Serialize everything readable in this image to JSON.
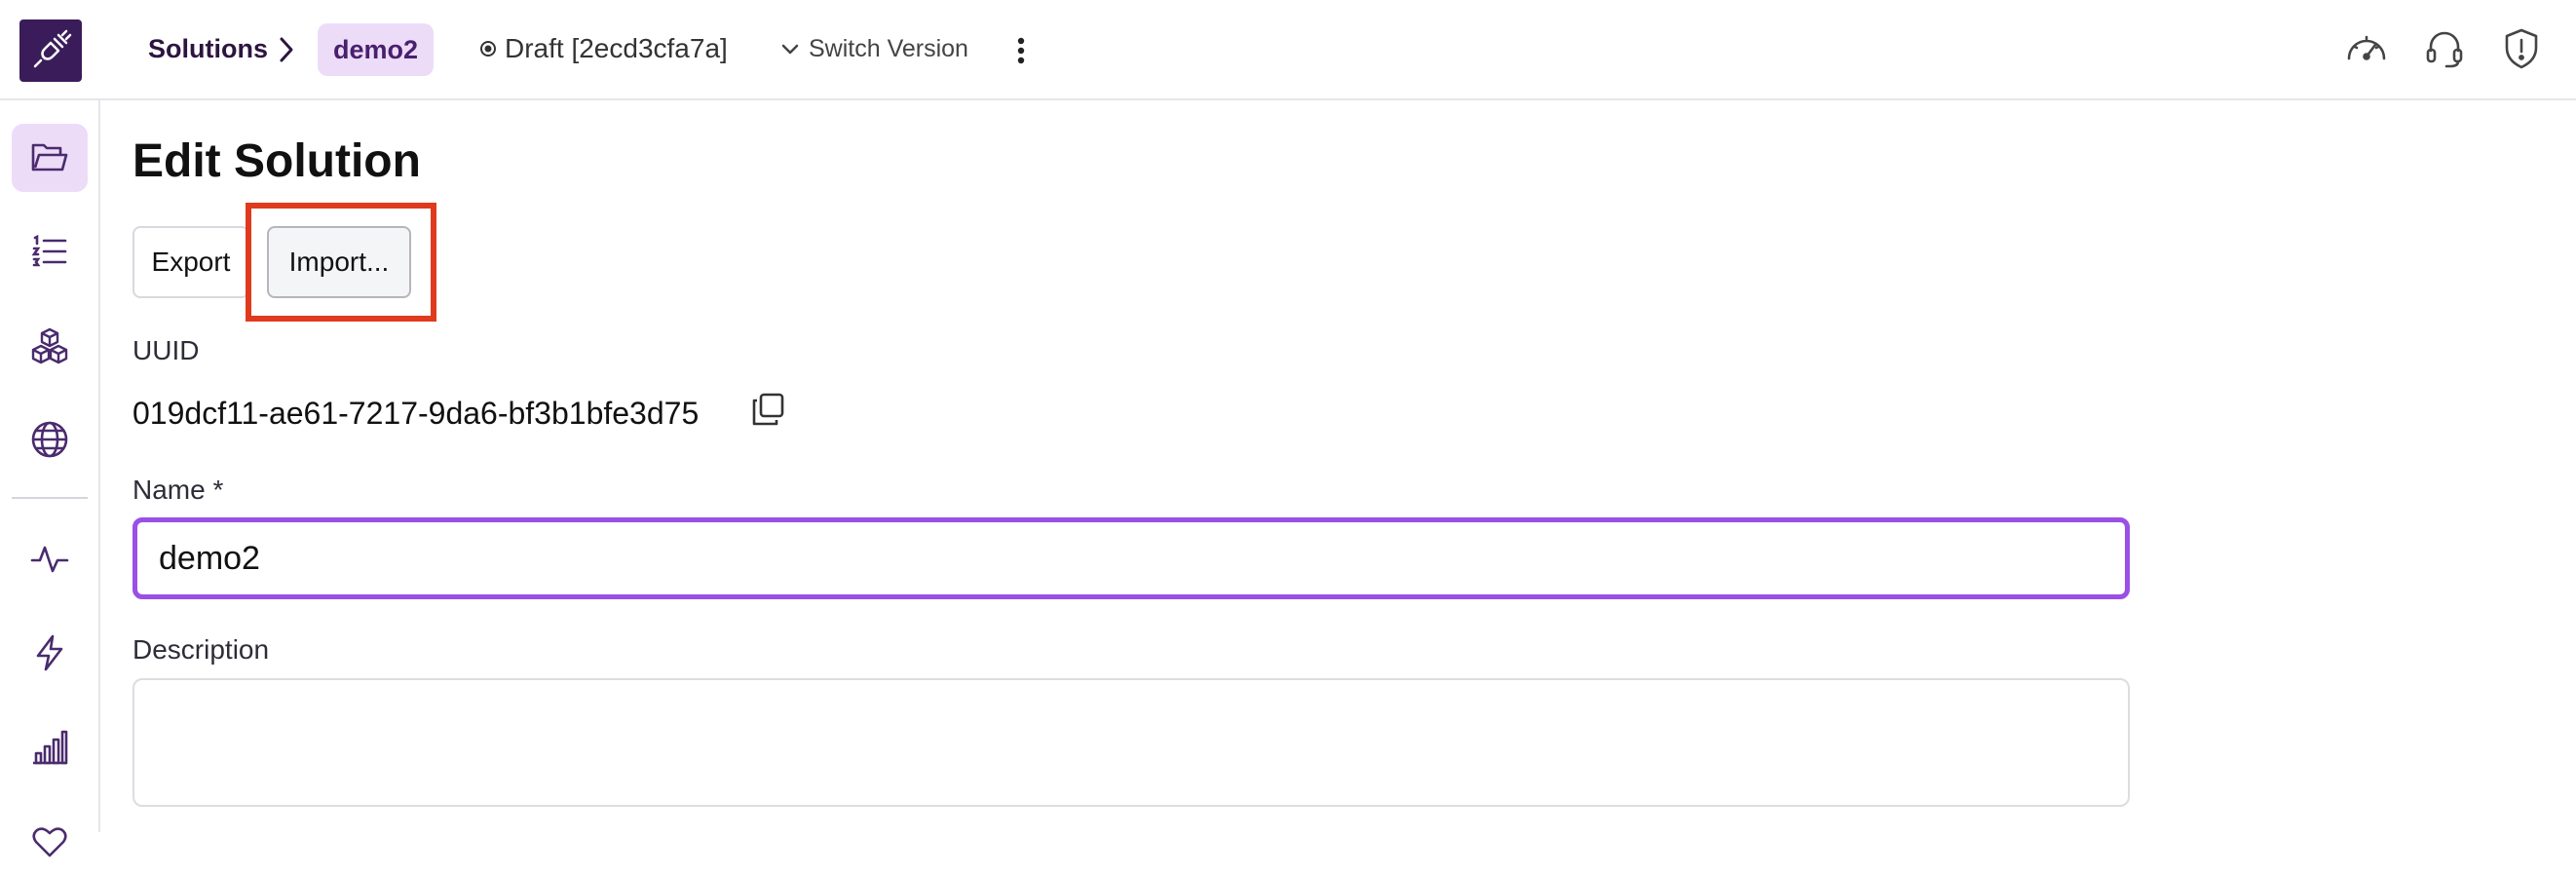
{
  "header": {
    "breadcrumb": {
      "root": "Solutions",
      "current": "demo2"
    },
    "version_label": "Draft [2ecd3cfa7a]",
    "switch_version_label": "Switch Version",
    "right_icons": [
      "dashboard-gauge-icon",
      "headset-support-icon",
      "shield-alert-icon"
    ]
  },
  "sidebar": {
    "items": [
      {
        "icon": "folder-icon",
        "active": true
      },
      {
        "icon": "numbered-list-icon",
        "active": false
      },
      {
        "icon": "cubes-icon",
        "active": false
      },
      {
        "icon": "globe-icon",
        "active": false
      },
      {
        "icon": "activity-pulse-icon",
        "active": false
      },
      {
        "icon": "lightning-icon",
        "active": false
      },
      {
        "icon": "bar-chart-icon",
        "active": false
      }
    ]
  },
  "main": {
    "title": "Edit Solution",
    "buttons": {
      "export": "Export",
      "import": "Import..."
    },
    "uuid_label": "UUID",
    "uuid_value": "019dcf11-ae61-7217-9da6-bf3b1bfe3d75",
    "name_label": "Name *",
    "name_value": "demo2",
    "description_label": "Description",
    "description_value": ""
  },
  "colors": {
    "brand": "#3b1c5a",
    "accent": "#9a4fe6",
    "active_bg": "#ecdcf8",
    "highlight": "#e03a1e"
  }
}
